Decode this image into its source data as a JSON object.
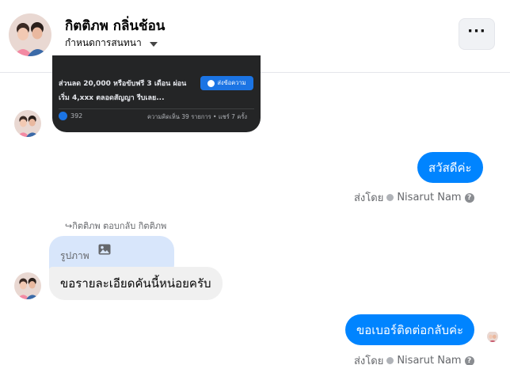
{
  "header": {
    "contact_name": "กิตติภพ กลิ่นช้อน",
    "subtitle": "กำหนดการสนทนา",
    "more_label": "···",
    "avatar_icon": "couple-photo-avatar"
  },
  "ad_card": {
    "text_line1": "ส่วนลด 20,000 หรือขับฟรี 3 เดือน ผ่อน",
    "text_line2": "เริ่ม 4,xxx ตลอดสัญญา รีบเลย...",
    "send_button_label": "ส่งข้อความ",
    "like_count": "392",
    "stats": "ความคิดเห็น 39 รายการ • แชร์ 7 ครั้ง"
  },
  "messages": {
    "out_1": "สวัสดีค่ะ",
    "sent_by_1_prefix": "ส่งโดย",
    "sent_by_1_name": "Nisarut Nam",
    "reply_label": "↪กิตติภพ ตอบกลับ กิตติภพ",
    "quote_text": "รูปภาพ",
    "in_1": "ขอรายละเอียดคันนี้หน่อยครับ",
    "out_2": "ขอเบอร์ติดต่อกลับค่ะ",
    "sent_by_2_prefix": "ส่งโดย",
    "sent_by_2_name": "Nisarut Nam"
  },
  "colors": {
    "outgoing_bubble": "#0084ff",
    "incoming_bubble": "#f0f0f0",
    "quote_bubble": "#d8e6fb",
    "ad_card_bg": "#242526"
  }
}
